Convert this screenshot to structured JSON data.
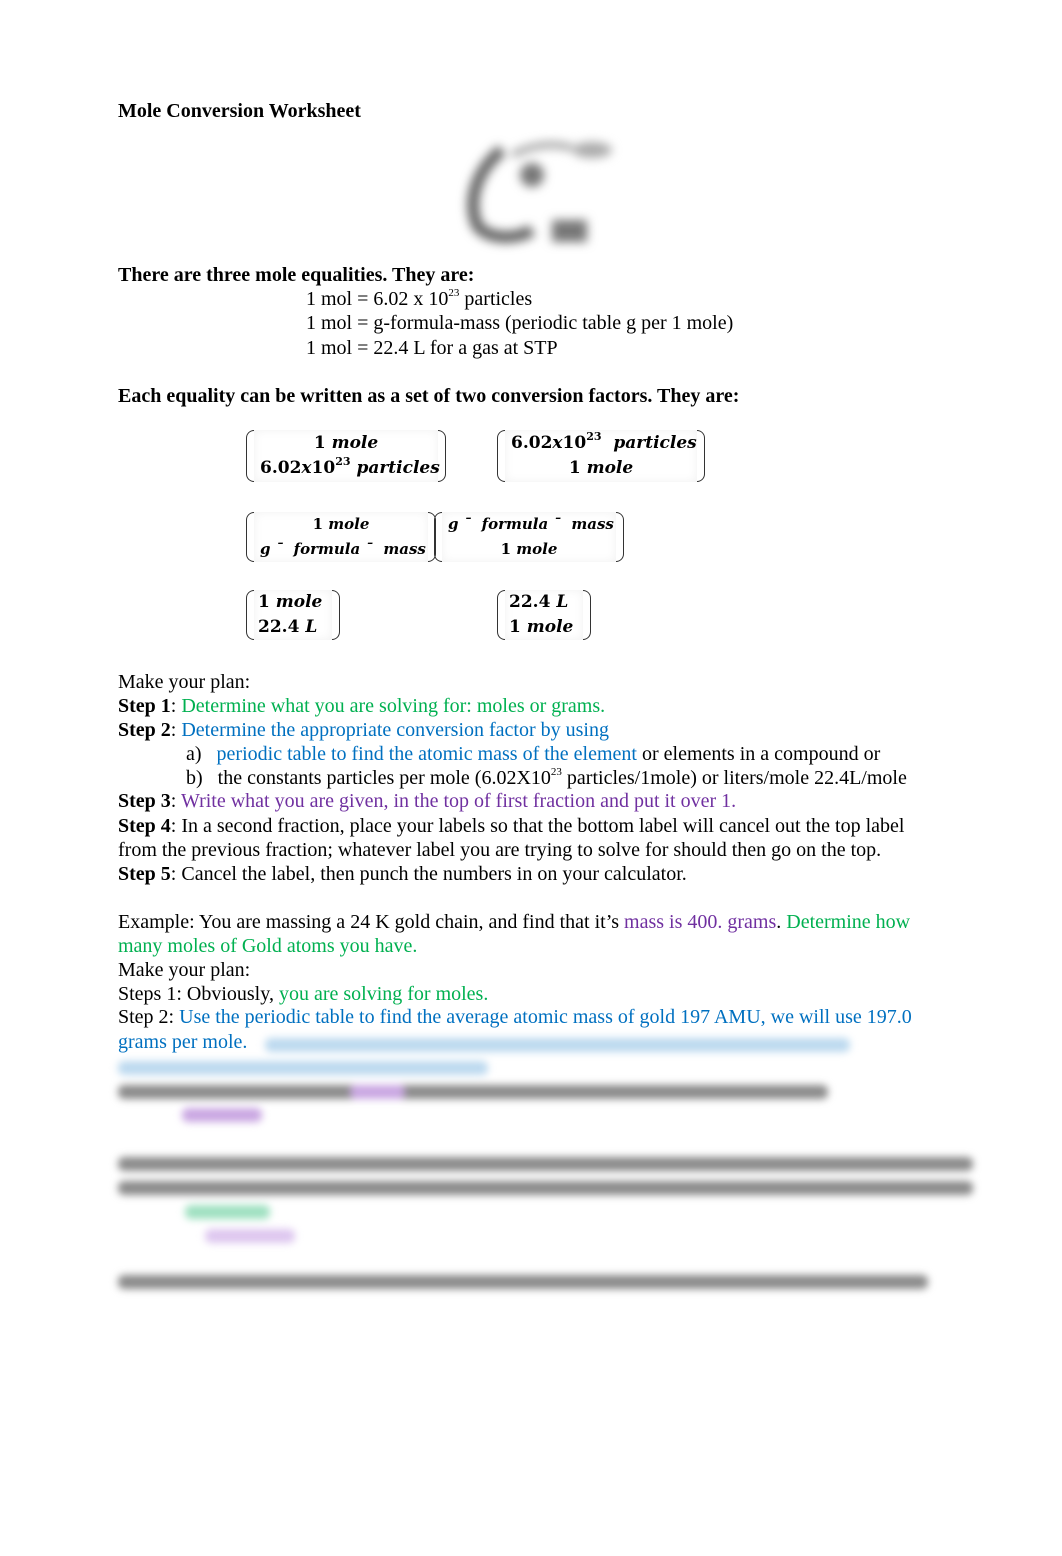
{
  "document": {
    "title": "Mole Conversion Worksheet",
    "diagram_icon": "mole-map-diagram",
    "equalities_heading": "There are three mole equalities. They are:",
    "equalities": [
      {
        "prefix": "1 mol = 6.02 x 10",
        "sup": "23",
        "suffix": " particles"
      },
      {
        "prefix": "1 mol = g-formula-mass (periodic table g per 1 mole)",
        "sup": "",
        "suffix": ""
      },
      {
        "prefix": "1 mol = 22.4 L for a gas at STP",
        "sup": "",
        "suffix": ""
      }
    ],
    "factors_heading": "Each equality can be written as a set of two conversion factors. They are:",
    "factors": [
      {
        "top_num": "1",
        "top_unit": "mole",
        "bottom_num": "6.02",
        "bottom_x": "x",
        "bottom_base": "10",
        "bottom_sup": "23",
        "bottom_unit": "particles"
      },
      {
        "top_num": "6.02",
        "top_x": "x",
        "top_base": "10",
        "top_sup": "23",
        "top_unit": "particles",
        "bottom_num": "1",
        "bottom_unit": "mole"
      },
      {
        "top_num": "1",
        "top_unit": "mole",
        "bottom_text": "g ¯  formula ¯  mass"
      },
      {
        "top_text": "g ¯  formula ¯  mass",
        "bottom_num": "1",
        "bottom_unit": "mole"
      },
      {
        "top_num": "1",
        "top_unit": "mole",
        "bottom_num": "22.4",
        "bottom_unit": "L"
      },
      {
        "top_num": "22.4",
        "top_unit": "L",
        "bottom_num": "1",
        "bottom_unit": "mole"
      }
    ],
    "plan_heading": "Make your plan:",
    "steps": {
      "step1_label": "Step 1",
      "step1_text": "Determine what you are solving for: moles or grams.",
      "step2_label": "Step 2",
      "step2_text": "Determine the appropriate conversion factor by using",
      "step2a_marker": "a)",
      "step2a_colored": "periodic table to find the atomic mass of the element",
      "step2a_rest": " or elements in a compound  or",
      "step2b_marker": "b)",
      "step2b_prefix": "the constants particles per mole (6.02X10",
      "step2b_sup": "23",
      "step2b_suffix": " particles/1mole)  or   liters/mole 22.4L/mole",
      "step3_label": "Step 3",
      "step3_text": "Write what you are given, in the top of first fraction and put it over 1.",
      "step4_label": "Step 4",
      "step4_line1": "In a second fraction, place your labels so that the bottom label will cancel out the top label",
      "step4_line2": "from the previous fraction; whatever label you are trying to solve for should then go on the top.",
      "step5_label": "Step 5",
      "step5_text": "Cancel the label, then punch the numbers in on your calculator."
    },
    "example": {
      "intro": "Example:  You are massing a 24 K gold chain, and find that it’s ",
      "given": "mass is 400. grams",
      "period": ".  ",
      "question_line1": "Determine how",
      "question_line2": "many moles of Gold atoms you have.",
      "plan_heading": "Make your plan:",
      "step1_prefix": "Steps 1: Obviously, ",
      "step1_colored": "you are solving for moles.",
      "step2_prefix": "Step 2: ",
      "step2_line1": "Use the periodic table to find the average atomic mass of gold 197 AMU, we will use 197.0",
      "step2_line2": "grams per mole."
    },
    "colors": {
      "green": "#00b050",
      "blue": "#0070c0",
      "purple": "#7030a0",
      "text": "#000000"
    }
  }
}
